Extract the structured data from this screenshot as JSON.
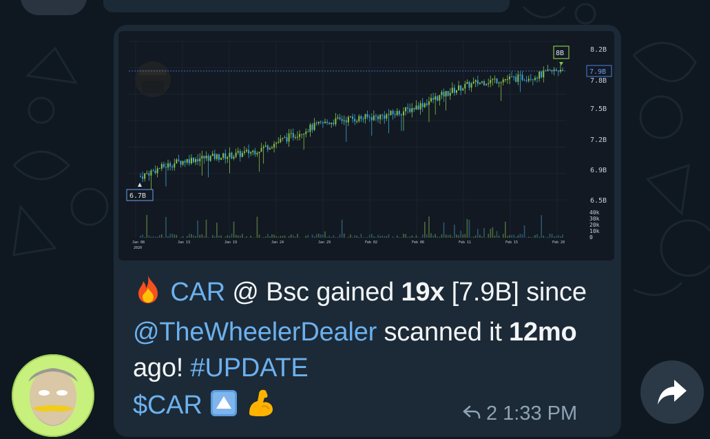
{
  "chart_data": {
    "type": "candlestick",
    "y_ticks": [
      "8.2B",
      "7.9B",
      "7.8B",
      "7.5B",
      "7.2B",
      "6.9B",
      "6.5B"
    ],
    "current_price_label": "7.9B",
    "high_label": "8B",
    "low_label": "6.7B",
    "volume_ticks": [
      "40k",
      "30k",
      "20k",
      "10k",
      "0"
    ],
    "x_ticks": [
      "Jan 08",
      "Jan 13",
      "Jan 19",
      "Jan 24",
      "Jan 29",
      "Feb 02",
      "Feb 06",
      "Feb 11",
      "Feb 15",
      "Feb 20"
    ],
    "x_year": "2020",
    "ylim": [
      6.5,
      8.2
    ],
    "trend_start": 6.75,
    "trend_end": 7.95
  },
  "message": {
    "text_1": " ",
    "token": "CAR",
    "text_2": " @ Bsc gained ",
    "gain": "19x",
    "text_3": " [7.9B] since ",
    "mention": "@TheWheelerDealer",
    "text_4": " scanned it ",
    "age": "12mo",
    "text_5": " ago! ",
    "hashtag": "#UPDATE",
    "cashtag": "$CAR",
    "emoji_fire": "fire-emoji",
    "emoji_up": "up-button-emoji",
    "emoji_flex": "flexed-biceps-emoji"
  },
  "meta": {
    "replies": "2",
    "time": "1:33 PM"
  },
  "colors": {
    "bubble": "#1c2a37",
    "background": "#0f1820",
    "link": "#6cb1ee",
    "candle_up": "#8bc34a",
    "candle_down": "#3da9d8",
    "avatar_bg": "#c7f07d"
  }
}
